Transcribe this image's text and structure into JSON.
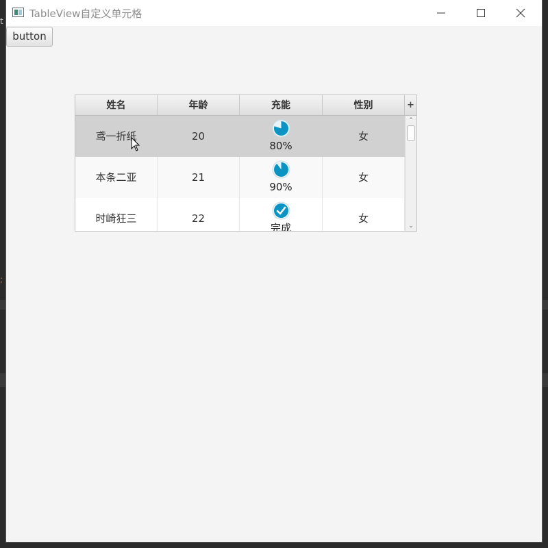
{
  "window": {
    "title": "TableView自定义单元格"
  },
  "toolbar": {
    "button_label": "button"
  },
  "table": {
    "columns": [
      "姓名",
      "年龄",
      "充能",
      "性别"
    ],
    "column_menu_icon": "plus-icon",
    "rows": [
      {
        "name": "鸢一折纸",
        "age": "20",
        "progress": 0.8,
        "progress_label": "80%",
        "gender": "女",
        "selected": true
      },
      {
        "name": "本条二亚",
        "age": "21",
        "progress": 0.9,
        "progress_label": "90%",
        "gender": "女",
        "selected": false
      },
      {
        "name": "时崎狂三",
        "age": "22",
        "progress": 1.0,
        "progress_label": "完成",
        "gender": "女",
        "selected": false
      }
    ]
  },
  "colors": {
    "progress": "#0a93c3",
    "selection": "#d1d1d1"
  }
}
